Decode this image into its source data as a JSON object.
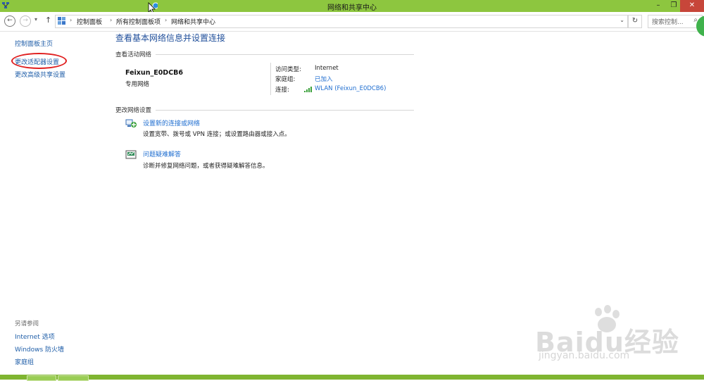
{
  "window": {
    "title": "网络和共享中心",
    "minimize": "–",
    "restore": "❐",
    "close": "✕"
  },
  "nav": {
    "back": "←",
    "forward": "→",
    "up": "↑",
    "breadcrumb": [
      "控制面板",
      "所有控制面板项",
      "网络和共享中心"
    ],
    "search_placeholder": "搜索控制..."
  },
  "sidebar": {
    "items": [
      {
        "label": "控制面板主页"
      },
      {
        "label": "更改适配器设置"
      },
      {
        "label": "更改高级共享设置"
      }
    ],
    "see_also": {
      "heading": "另请参阅",
      "items": [
        {
          "label": "Internet 选项"
        },
        {
          "label": "Windows 防火墙"
        },
        {
          "label": "家庭组"
        }
      ]
    }
  },
  "main": {
    "title": "查看基本网络信息并设置连接",
    "active_section": "查看活动网络",
    "network": {
      "name": "Feixun_E0DCB6",
      "type": "专用网络",
      "access_type_label": "访问类型:",
      "access_type_value": "Internet",
      "homegroup_label": "家庭组:",
      "homegroup_value": "已加入",
      "connection_label": "连接:",
      "connection_value": "WLAN (Feixun_E0DCB6)"
    },
    "settings_section": "更改网络设置",
    "tasks": [
      {
        "link": "设置新的连接或网络",
        "desc": "设置宽带、拨号或 VPN 连接；或设置路由器或接入点。",
        "icon": "new-connection-icon"
      },
      {
        "link": "问题疑难解答",
        "desc": "诊断并修复网络问题，或者获得疑难解答信息。",
        "icon": "troubleshoot-icon"
      }
    ]
  },
  "watermark": {
    "brand": "Baidu经验",
    "url": "jingyan.baidu.com"
  },
  "colors": {
    "titlebar": "#8dc63f",
    "link": "#1f6ed0",
    "heading": "#1f4e9a",
    "annotation": "#e01e1e"
  }
}
